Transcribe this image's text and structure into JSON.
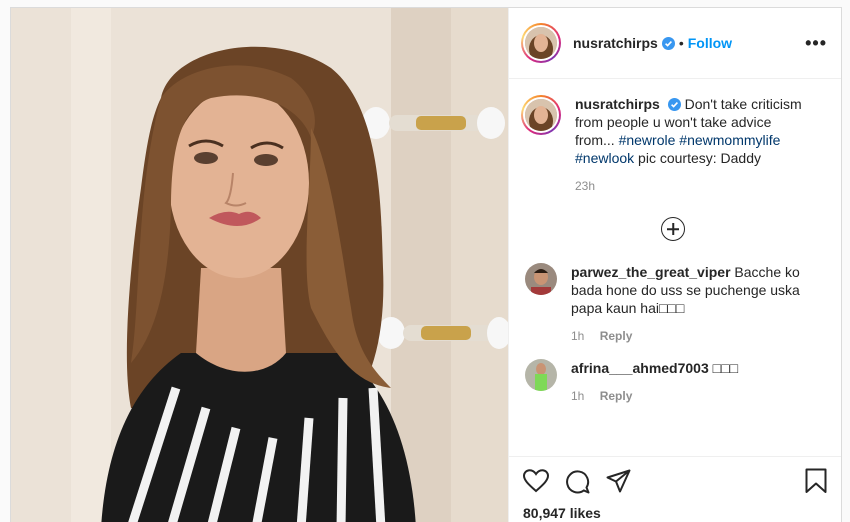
{
  "header": {
    "username": "nusratchirps",
    "dot": "•",
    "follow_label": "Follow",
    "more_label": "•••"
  },
  "caption": {
    "username": "nusratchirps",
    "text_before": "Don't take criticism from people u won't take advice from... ",
    "tags": [
      "#newrole",
      "#newmommylife",
      "#newlook"
    ],
    "text_after": " pic courtesy: Daddy",
    "time": "23h"
  },
  "comments": [
    {
      "username": "parwez_the_great_viper",
      "text": "Bacche ko bada hone do uss se puchenge uska papa kaun hai□□□",
      "time": "1h",
      "reply_label": "Reply"
    },
    {
      "username": "afrina___ahmed7003",
      "text": "□□□",
      "time": "1h",
      "reply_label": "Reply"
    }
  ],
  "footer": {
    "likes": "80,947 likes"
  },
  "icons": [
    "heart-icon",
    "comment-icon",
    "share-icon",
    "bookmark-icon",
    "verified-icon",
    "plus-circle-icon"
  ],
  "colors": {
    "link": "#0095f6",
    "hashtag": "#00376b",
    "muted": "#8e8e8e",
    "verified": "#3897f0"
  }
}
